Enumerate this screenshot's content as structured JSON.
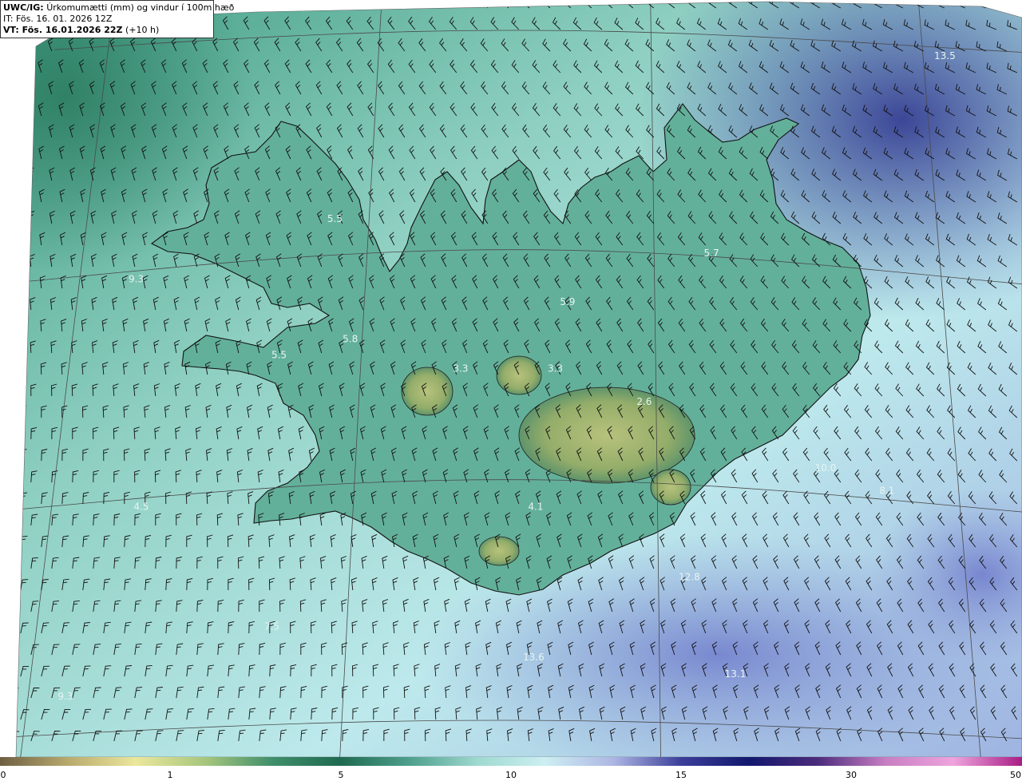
{
  "header": {
    "title_bold": "UWC/IG:",
    "title_rest": "Úrkomumætti (mm) og vindur í 100m hæð",
    "it_line": "IT: Fös. 16. 01. 2026 12Z",
    "vt_bold": "VT: Fös. 16.01.2026 22Z",
    "vt_rest": "(+10 h)"
  },
  "value_labels": [
    {
      "text": "13.5",
      "lon": -11.6,
      "lat": 67.9
    },
    {
      "text": "5.5",
      "lon": -22.6,
      "lat": 66.3
    },
    {
      "text": "9.3",
      "lon": -26.0,
      "lat": 65.9
    },
    {
      "text": "5.9",
      "lon": -18.5,
      "lat": 65.5
    },
    {
      "text": "5.7",
      "lon": -16.0,
      "lat": 66.0
    },
    {
      "text": "5.8",
      "lon": -22.2,
      "lat": 65.2
    },
    {
      "text": "5.5",
      "lon": -23.4,
      "lat": 65.1
    },
    {
      "text": "3.3",
      "lon": -20.3,
      "lat": 64.9
    },
    {
      "text": "3.3",
      "lon": -18.7,
      "lat": 64.9
    },
    {
      "text": "2.6",
      "lon": -17.2,
      "lat": 64.65
    },
    {
      "text": "4.1",
      "lon": -19.0,
      "lat": 63.75
    },
    {
      "text": "10.0",
      "lon": -14.2,
      "lat": 64.2
    },
    {
      "text": "8.1",
      "lon": -13.2,
      "lat": 64.05
    },
    {
      "text": "4.5",
      "lon": -25.5,
      "lat": 63.9
    },
    {
      "text": "12.8",
      "lon": -16.5,
      "lat": 63.2
    },
    {
      "text": "7.5",
      "lon": -23.2,
      "lat": 62.8
    },
    {
      "text": "13.6",
      "lon": -19.0,
      "lat": 62.5
    },
    {
      "text": "13.1",
      "lon": -15.8,
      "lat": 62.4
    },
    {
      "text": "9.3",
      "lon": -26.4,
      "lat": 62.3
    }
  ],
  "colorbar": {
    "ticks": [
      "0",
      "1",
      "5",
      "10",
      "15",
      "30",
      "50"
    ],
    "colors": [
      "#6e5f44",
      "#b9aa6e",
      "#ebe79c",
      "#a8c77d",
      "#3f8e6b",
      "#1f6a50",
      "#4d9f8c",
      "#9ed9cf",
      "#cdeff2",
      "#aeb6e4",
      "#3b3e99",
      "#12186e",
      "#4c2b7c",
      "#c87fc3",
      "#eea4dd",
      "#a81d85"
    ]
  },
  "wind": {
    "direction": "NE"
  }
}
